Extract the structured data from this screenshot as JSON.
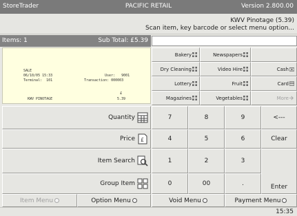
{
  "titlebar": {
    "app": "StoreTrader",
    "store": "PACIFIC RETAIL",
    "version": "Version 2.800.00"
  },
  "prompt": {
    "line1": "KWV Pinotage (5.39)",
    "line2": "Scan item, key barcode or select menu option..."
  },
  "summary": {
    "items": "Items: 1",
    "subtotal": "Sub Total: £5.39"
  },
  "barcode": {
    "value": ""
  },
  "receipt": {
    "sale": "SALE",
    "datetime": "06/10/05 15:33",
    "user": "User:   9001",
    "terminal": "Terminal:  101",
    "transaction": "Transaction: 000003",
    "currency": "£",
    "item_name": "KWV PINOTAGE",
    "item_price": "5.39"
  },
  "categories": {
    "bakery": "Bakery",
    "newspapers": "Newspapers",
    "dry_cleaning": "Dry Cleaning",
    "video_hire": "Video Hire",
    "lottery": "Lottery",
    "fruit": "Fruit",
    "magazines": "Magazines",
    "vegetables": "Vegetables"
  },
  "tenders": {
    "cash": "Cash",
    "card": "Card",
    "more": "More"
  },
  "actions": {
    "quantity": "Quantity",
    "price": "Price",
    "item_search": "Item Search",
    "group_item": "Group Item"
  },
  "keypad": {
    "k7": "7",
    "k8": "8",
    "k9": "9",
    "back": "<---",
    "k4": "4",
    "k5": "5",
    "k6": "6",
    "clear": "Clear",
    "k1": "1",
    "k2": "2",
    "k3": "3",
    "k0": "0",
    "k00": "00",
    "dot": ".",
    "enter": "Enter"
  },
  "menus": {
    "item": "Item Menu",
    "option": "Option Menu",
    "void": "Void Menu",
    "payment": "Payment Menu"
  },
  "status": {
    "time": "15:35"
  },
  "colors": {
    "titlebar": "#7a7a7a",
    "receipt_bg": "#ffffe0",
    "button_bg": "#e6e6e2"
  }
}
